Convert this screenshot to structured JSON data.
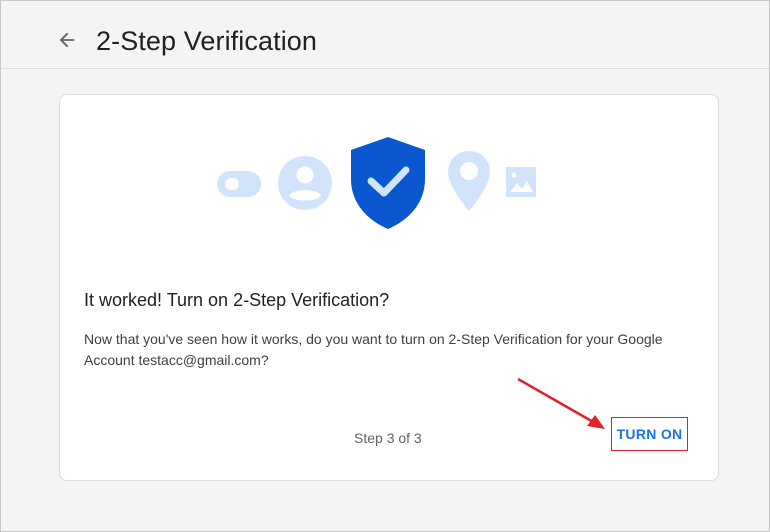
{
  "header": {
    "title": "2-Step Verification",
    "back_icon": "arrow-back-icon"
  },
  "card": {
    "heading": "It worked! Turn on 2-Step Verification?",
    "description": "Now that you've seen how it works, do you want to turn on 2-Step Verification for your Google Account testacc@gmail.com?",
    "step_label": "Step 3 of 3",
    "turn_on_label": "TURN ON",
    "illustration_icons": [
      "toggle-icon",
      "account-circle-icon",
      "shield-check-icon",
      "location-pin-icon",
      "image-icon"
    ]
  },
  "colors": {
    "accent": "#1a73e8",
    "shield": "#0b57d0",
    "light_icon": "#d2e3fc",
    "annotation_red": "#e0202a"
  }
}
